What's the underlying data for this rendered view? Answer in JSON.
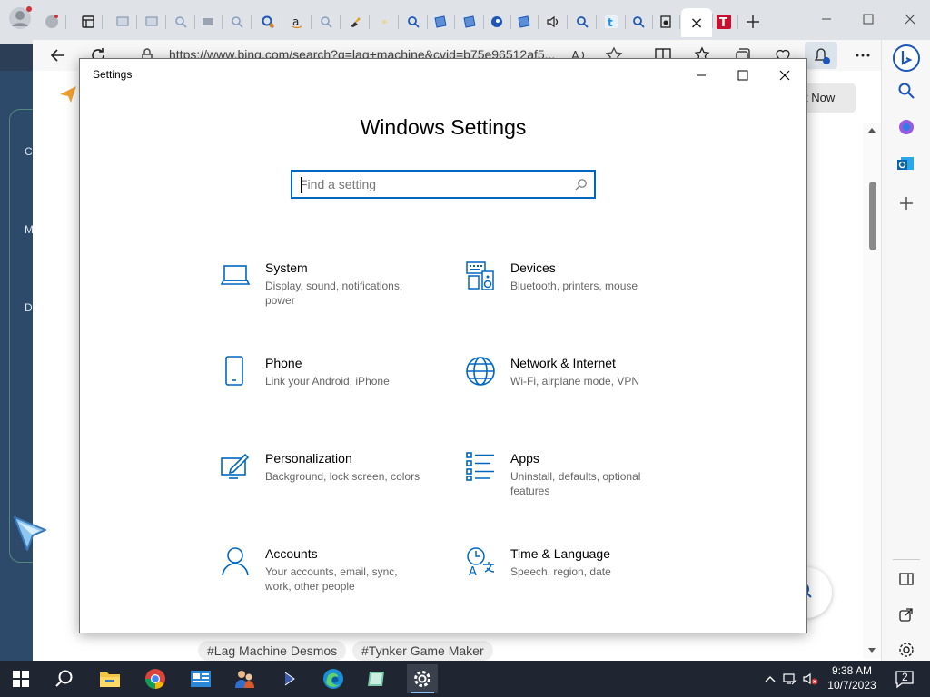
{
  "browser": {
    "url": "https://www.bing.com/search?q=lag+machine&cvid=b75e96512af5...",
    "tabs": [
      "profile",
      "tab-icon",
      "page",
      "page",
      "search",
      "page",
      "search",
      "search",
      "amazon",
      "search",
      "pin",
      "dot",
      "search",
      "page",
      "page",
      "edge",
      "page",
      "sound",
      "search",
      "t",
      "search",
      "page"
    ],
    "active_tab_close": "×",
    "new_tab": "+"
  },
  "background_page": {
    "not_now": "t Now",
    "left_labels": [
      "C",
      "M",
      "D"
    ],
    "tags": [
      "#Lag Machine Desmos",
      "#Tynker Game Maker"
    ]
  },
  "window": {
    "title": "Settings",
    "heading": "Windows Settings",
    "search_placeholder": "Find a setting"
  },
  "categories": [
    {
      "title": "System",
      "desc": "Display, sound, notifications, power",
      "icon": "laptop-icon"
    },
    {
      "title": "Devices",
      "desc": "Bluetooth, printers, mouse",
      "icon": "keyboard-speaker-icon"
    },
    {
      "title": "Phone",
      "desc": "Link your Android, iPhone",
      "icon": "phone-icon"
    },
    {
      "title": "Network & Internet",
      "desc": "Wi-Fi, airplane mode, VPN",
      "icon": "globe-icon"
    },
    {
      "title": "Personalization",
      "desc": "Background, lock screen, colors",
      "icon": "paint-screen-icon"
    },
    {
      "title": "Apps",
      "desc": "Uninstall, defaults, optional features",
      "icon": "list-icon"
    },
    {
      "title": "Accounts",
      "desc": "Your accounts, email, sync, work, other people",
      "icon": "person-icon"
    },
    {
      "title": "Time & Language",
      "desc": "Speech, region, date",
      "icon": "time-language-icon"
    }
  ],
  "taskbar": {
    "time": "9:38 AM",
    "date": "10/7/2023",
    "notifications_count": "2",
    "apps": [
      "start-icon",
      "search-icon",
      "file-explorer-icon",
      "chrome-icon",
      "app-icon",
      "people-icon",
      "terminal-icon",
      "edge-icon",
      "app-icon",
      "settings-icon"
    ]
  },
  "colors": {
    "accent": "#0067c0",
    "taskbar": "#1f2631",
    "icon_blue": "#0067c0"
  }
}
